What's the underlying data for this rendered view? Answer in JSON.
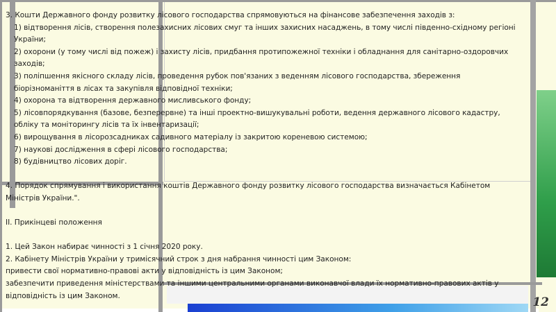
{
  "document": {
    "lines": [
      "3. Кошти Державного фонду розвитку лісового господарства спрямовуються на фінансове забезпечення  заходів з:",
      "1) відтворення лісів, створення полезахисних лісових смуг та інших захисних насаджень, в тому числі південно-східному регіоні",
      "України;",
      "2) охорони (у тому числі від пожеж) і захисту лісів, придбання протипожежної техніки і обладнання для санітарно-оздоровчих",
      "заходів;",
      "3) поліпшення якісного складу лісів, проведення рубок пов'язаних з веденням лісового господарства, збереження",
      "біорізноманіття в лісах та закупівля відповідної техніки;",
      "4) охорона та відтворення державного мисливського фонду;",
      "5) лісовпорядкування (базове, безперервне) та інші проектно-вишукувальні роботи, ведення державного лісового кадастру,",
      "обліку та моніторингу лісів та їх інвентаризації;",
      "6) вирощування в лісорозсадниках садивного матеріалу із закритою кореневою системою;",
      "7) наукові дослідження в сфері лісового господарства;",
      "8) будівництво лісових доріг.",
      "4. Порядок спрямування і використання коштів  Державного фонду розвитку лісового господарства  визначається Кабінетом",
      "Міністрів України.\".",
      "ІІ. Прикінцеві положення",
      "1. Цей Закон набирає чинності з 1 січня 2020 року.",
      "2. Кабінету Міністрів України у тримісячний строк з дня набрання чинності цим Законом:",
      "привести свої нормативно-правові акти у відповідність із цим Законом;",
      "забезпечити приведення міністерствами та іншими центральними органами виконавчої влади їх нормативно-правових актів у",
      "відповідність із цим Законом."
    ]
  },
  "page_number": "12"
}
